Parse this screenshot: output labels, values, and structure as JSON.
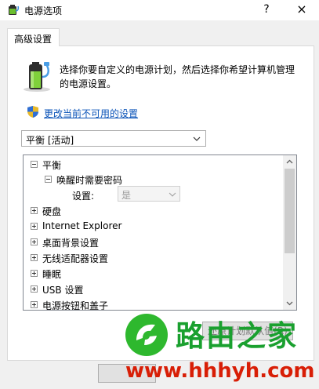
{
  "window": {
    "title": "电源选项",
    "help_label": "?",
    "close_label": "×"
  },
  "tab": {
    "label": "高级设置"
  },
  "intro": {
    "line1": "选择你要自定义的电源计划，然后选择你希望计算机管理",
    "line2": "的电源设置。"
  },
  "change_link": "更改当前不可用的设置",
  "plan_select": {
    "value": "平衡 [活动]"
  },
  "tree": {
    "root": "平衡",
    "password_node": "唤醒时需要密码",
    "setting_label": "设置:",
    "setting_value": "是",
    "items": [
      "硬盘",
      "Internet Explorer",
      "桌面背景设置",
      "无线适配器设置",
      "睡眠",
      "USB 设置",
      "电源按钮和盖子"
    ]
  },
  "buttons": {
    "restore": "还原计划默认值(R)"
  },
  "watermark": {
    "name": "路由之家",
    "url": "www.hhhyh.com"
  }
}
